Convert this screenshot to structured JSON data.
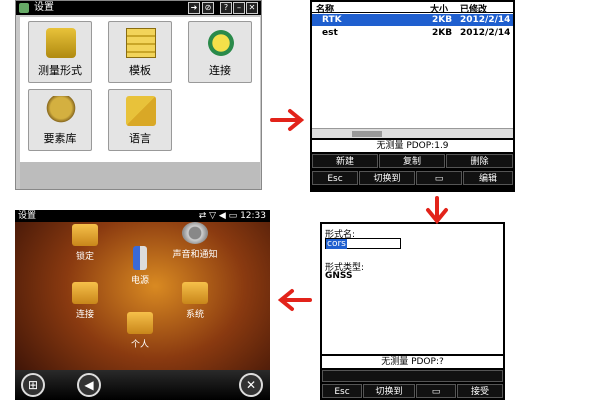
{
  "settings": {
    "title": "设置",
    "tiles": [
      "测量形式",
      "模板",
      "连接",
      "要素库",
      "语言"
    ]
  },
  "file_list": {
    "columns": [
      "名称",
      "大小",
      "已修改"
    ],
    "rows": [
      {
        "name": "RTK",
        "size": "2KB",
        "date": "2012/2/14"
      },
      {
        "name": "est",
        "size": "2KB",
        "date": "2012/2/14"
      }
    ],
    "status": "无测量  PDOP:1.9",
    "soft_row1": [
      "新建",
      "复制",
      "删除"
    ],
    "soft_row2": [
      "Esc",
      "切换到",
      "",
      "编辑"
    ]
  },
  "wm_settings": {
    "title": "设置",
    "time": "12:33",
    "items": [
      "锁定",
      "声音和通知",
      "电源",
      "连接",
      "系统",
      "个人"
    ]
  },
  "form": {
    "name_label": "形式名:",
    "name_value": "cors",
    "type_label": "形式类型:",
    "type_value": "GNSS",
    "status": "无测量  PDOP:?",
    "soft_row": [
      "Esc",
      "切换到",
      "",
      "接受"
    ]
  },
  "colors": {
    "arrow": "#e2231a",
    "selection": "#1f5fcf"
  }
}
